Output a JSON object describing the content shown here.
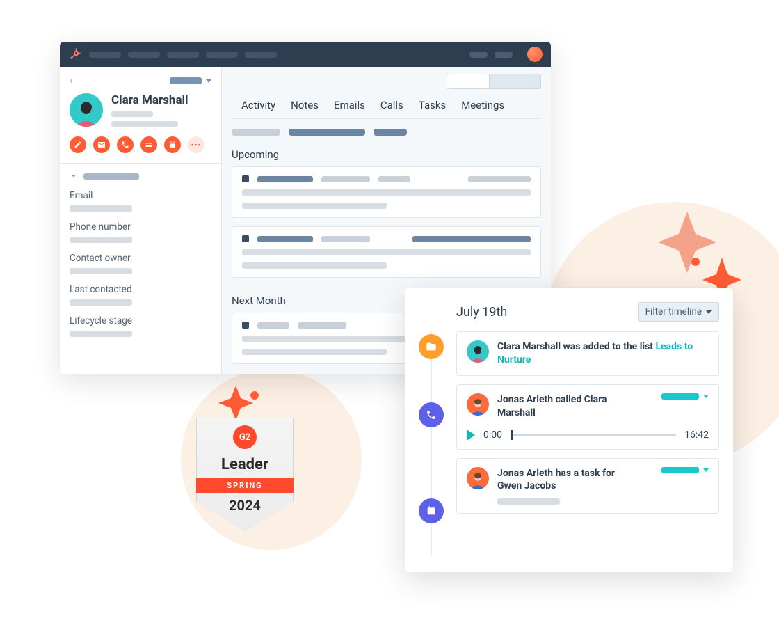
{
  "contact": {
    "name": "Clara Marshall",
    "fields": [
      "Email",
      "Phone number",
      "Contact owner",
      "Last contacted",
      "Lifecycle stage"
    ]
  },
  "tabs": [
    "Activity",
    "Notes",
    "Emails",
    "Calls",
    "Tasks",
    "Meetings"
  ],
  "sections": {
    "upcoming": "Upcoming",
    "nextMonth": "Next Month"
  },
  "icons": [
    "edit-icon",
    "email-icon",
    "phone-icon",
    "payment-icon",
    "calendar-icon",
    "more-icon"
  ],
  "timeline": {
    "date": "July 19th",
    "filterLabel": "Filter timeline",
    "items": [
      {
        "textPrefix": "Clara Marshall was added to the list ",
        "link": "Leads to Nurture"
      },
      {
        "text": "Jonas Arleth called Clara Marshall",
        "audio": {
          "start": "0:00",
          "end": "16:42"
        }
      },
      {
        "text": "Jonas Arleth has a task for Gwen Jacobs"
      }
    ]
  },
  "badge": {
    "logo": "G2",
    "title": "Leader",
    "season": "SPRING",
    "year": "2024"
  }
}
